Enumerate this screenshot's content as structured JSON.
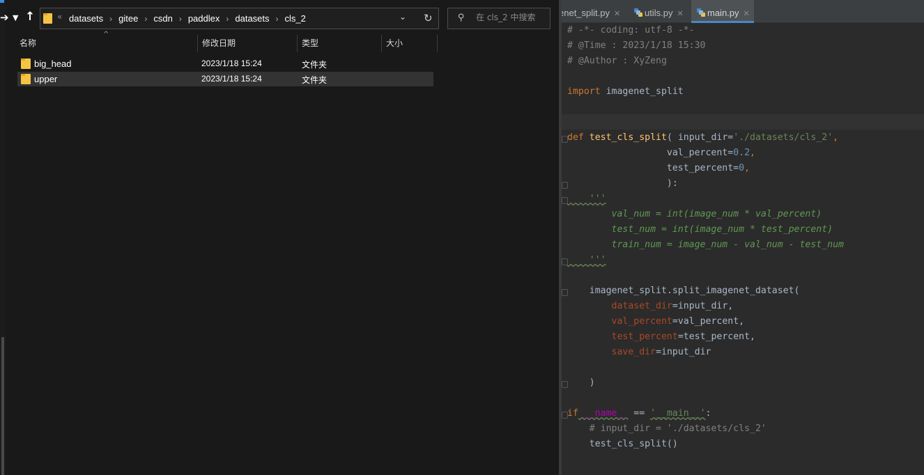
{
  "explorer": {
    "nav": {
      "forward_icon": "arrow-right-icon",
      "recent_icon": "chevron-down-icon",
      "up_icon": "arrow-up-icon"
    },
    "address": {
      "overflow": "«",
      "crumbs": [
        "datasets",
        "gitee",
        "csdn",
        "paddlex",
        "datasets",
        "cls_2"
      ],
      "separator": "›"
    },
    "search": {
      "placeholder": "在 cls_2 中搜索"
    },
    "columns": {
      "name": "名称",
      "date": "修改日期",
      "type": "类型",
      "size": "大小"
    },
    "files": [
      {
        "name": "big_head",
        "date": "2023/1/18 15:24",
        "type": "文件夹",
        "selected": false
      },
      {
        "name": "upper",
        "date": "2023/1/18 15:24",
        "type": "文件夹",
        "selected": true
      }
    ]
  },
  "editor": {
    "tabs": [
      {
        "label": "enet_split.py",
        "active": false
      },
      {
        "label": "utils.py",
        "active": false
      },
      {
        "label": "main.py",
        "active": true
      }
    ],
    "code": {
      "l1": "# -*- coding: utf-8 -*-",
      "l2": "# @Time : 2023/1/18 15:30",
      "l3": "# @Author : XyZeng",
      "l4_kw": "import",
      "l4_mod": " imagenet_split",
      "l5_kw": "def",
      "l5_fn": "test_cls_split",
      "l5_a": "( input_dir=",
      "l5_str": "'./datasets/cls_2'",
      "l5_b": ",",
      "l6_a": "                  val_percent=",
      "l6_num": "0.2",
      "l6_b": ",",
      "l7_a": "                  test_percent=",
      "l7_num": "0",
      "l7_b": ",",
      "l8": "                  ):",
      "l9": "    '''",
      "l10": "        val_num = int(image_num * val_percent)",
      "l11": "        test_num = int(image_num * test_percent)",
      "l12": "        train_num = image_num - val_num - test_num",
      "l13": "    '''",
      "l14": "    imagenet_split.split_imagenet_dataset(",
      "l15_p": "dataset_dir",
      "l15_v": "=input_dir,",
      "l16_p": "val_percent",
      "l16_v": "=val_percent,",
      "l17_p": "test_percent",
      "l17_v": "=test_percent,",
      "l18_p": "save_dir",
      "l18_v": "=input_dir",
      "l19": "    )",
      "l20_kw": "if",
      "l20_name": " __name__",
      "l20_op": " == ",
      "l20_str": "'__main__'",
      "l20_end": ":",
      "l21": "    # input_dir = './datasets/cls_2'",
      "l22": "    test_cls_split()"
    }
  }
}
